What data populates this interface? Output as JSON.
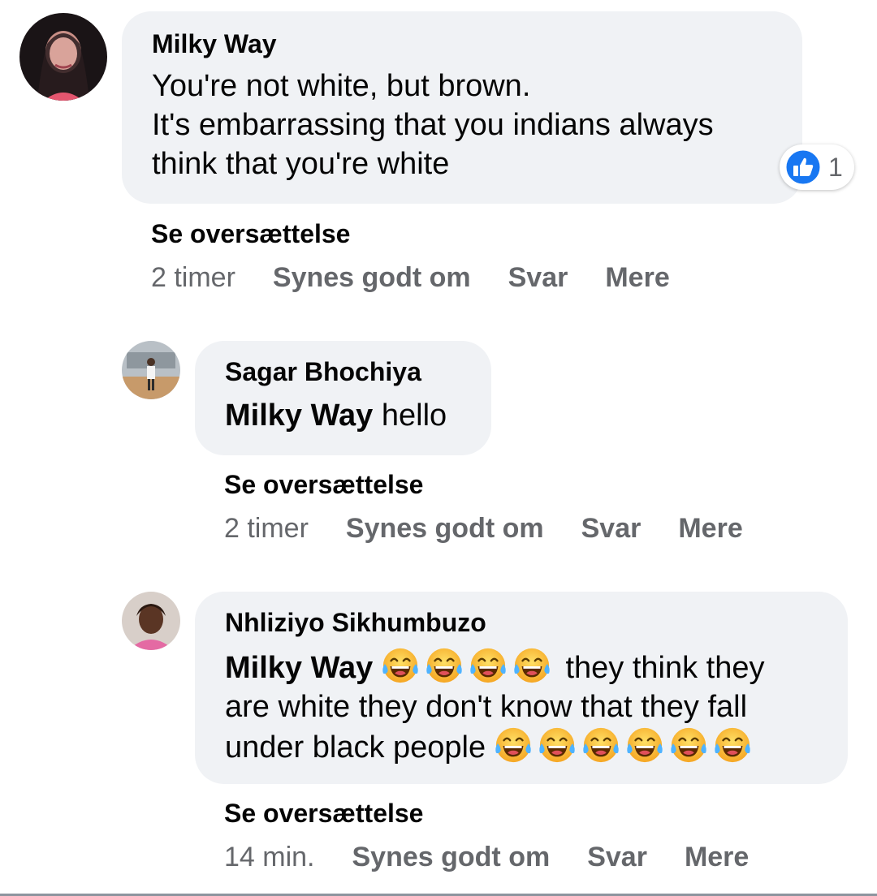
{
  "comments": [
    {
      "author": "Milky Way",
      "text_lines": [
        "You're not white, but brown.",
        "It's embarrassing that you indians always",
        "think that you're white"
      ],
      "reaction": {
        "icon": "like-icon",
        "count": "1"
      },
      "translate": "Se oversættelse",
      "time": "2 timer",
      "like": "Synes godt om",
      "reply": "Svar",
      "more": "Mere"
    },
    {
      "author": "Sagar Bhochiya",
      "mention": "Milky Way",
      "text": "hello",
      "translate": "Se oversættelse",
      "time": "2 timer",
      "like": "Synes godt om",
      "reply": "Svar",
      "more": "Mere"
    },
    {
      "author": "Nhliziyo Sikhumbuzo",
      "mention": "Milky Way",
      "text_line1": "they think they",
      "text_line2": "are white they don't know that they fall",
      "text_line3": "under black people",
      "emoji": "face-with-tears-of-joy",
      "translate": "Se oversættelse",
      "time": "14 min.",
      "like": "Synes godt om",
      "reply": "Svar",
      "more": "Mere"
    }
  ],
  "colors": {
    "bubble": "#f0f2f5",
    "muted": "#65676b",
    "like_blue": "#1877f2"
  }
}
